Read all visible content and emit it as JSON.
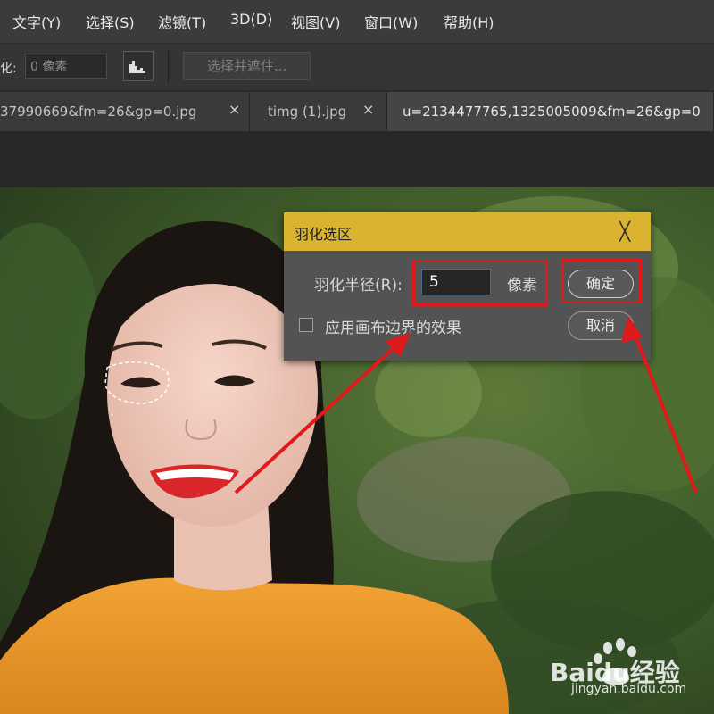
{
  "menubar": {
    "items": [
      {
        "label": "文字(Y)"
      },
      {
        "label": "选择(S)"
      },
      {
        "label": "滤镜(T)"
      },
      {
        "label": "3D(D)"
      },
      {
        "label": "视图(V)"
      },
      {
        "label": "窗口(W)"
      },
      {
        "label": "帮助(H)"
      }
    ]
  },
  "options": {
    "feather_label": "化:",
    "feather_value": "0 像素",
    "select_mask_label": "选择并遮住..."
  },
  "tabs": [
    {
      "label": "37990669&fm=26&gp=0.jpg",
      "close": "×"
    },
    {
      "label": "timg (1).jpg",
      "close": "×"
    },
    {
      "label": "u=2134477765,1325005009&fm=26&gp=0"
    }
  ],
  "dialog": {
    "title": "羽化选区",
    "close": "╳",
    "radius_label": "羽化半径(R):",
    "radius_value": "5",
    "unit": "像素",
    "checkbox_label": "应用画布边界的效果",
    "checkbox_checked": false,
    "ok_label": "确定",
    "cancel_label": "取消"
  },
  "watermark": {
    "brand": "Baidu经验",
    "url": "jingyan.baidu.com"
  },
  "colors": {
    "dialog_title_bar": "#dab331",
    "annotation": "#e01a1a"
  }
}
